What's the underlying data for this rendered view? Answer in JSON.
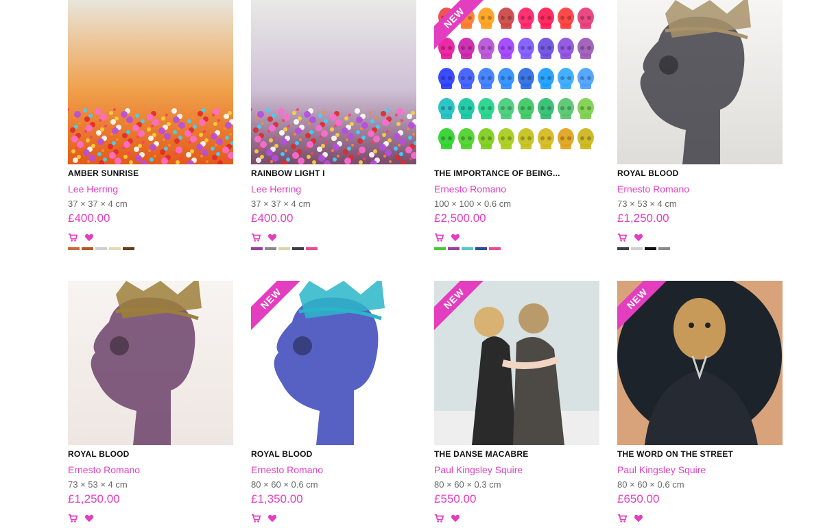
{
  "products": [
    {
      "title": "AMBER SUNRISE",
      "artist": "Lee Herring",
      "dims": "37 × 37 × 4 cm",
      "price": "£400.00",
      "new": false,
      "art": "amber-sunrise",
      "swatches": [
        "#c76a3a",
        "#b35a2c",
        "#cfcfcf",
        "#e8d9b0",
        "#6b3b14"
      ]
    },
    {
      "title": "RAINBOW LIGHT I",
      "artist": "Lee Herring",
      "dims": "37 × 37 × 4 cm",
      "price": "£400.00",
      "new": false,
      "art": "rainbow-light",
      "swatches": [
        "#9b3ea0",
        "#8a8a8a",
        "#ddd4aa",
        "#3c3f4a",
        "#e74d96"
      ]
    },
    {
      "title": "THE IMPORTANCE OF BEING...",
      "artist": "Ernesto Romano",
      "dims": "100 × 100 × 0.6 cm",
      "price": "£2,500.00",
      "new": true,
      "ribbon": "NEW",
      "art": "skull-grid",
      "swatches": [
        "#4fc73d",
        "#9b3ea0",
        "#57c9c9",
        "#334a9e",
        "#e74d96"
      ]
    },
    {
      "title": "ROYAL BLOOD",
      "artist": "Ernesto Romano",
      "dims": "73 × 53 × 4 cm",
      "price": "£1,250.00",
      "new": false,
      "art": "royal-blood-grey",
      "swatches": [
        "#3c3f4a",
        "#cfcfcf",
        "#111111",
        "#8a8a8a"
      ]
    },
    {
      "title": "ROYAL BLOOD",
      "artist": "Ernesto Romano",
      "dims": "73 × 53 × 4 cm",
      "price": "£1,250.00",
      "new": false,
      "art": "royal-blood-purple",
      "swatches": []
    },
    {
      "title": "ROYAL BLOOD",
      "artist": "Ernesto Romano",
      "dims": "80 × 60 × 0.6 cm",
      "price": "£1,350.00",
      "new": true,
      "ribbon": "NEW",
      "art": "royal-blood-blue",
      "swatches": []
    },
    {
      "title": "THE DANSE MACABRE",
      "artist": "Paul Kingsley Squire",
      "dims": "80 × 60 × 0.3 cm",
      "price": "£550.00",
      "new": true,
      "ribbon": "NEW",
      "art": "danse-macabre",
      "swatches": []
    },
    {
      "title": "THE WORD ON THE STREET",
      "artist": "Paul Kingsley Squire",
      "dims": "80 × 60 × 0.6 cm",
      "price": "£650.00",
      "new": true,
      "ribbon": "NEW",
      "art": "word-on-street",
      "swatches": []
    }
  ],
  "icons": {
    "cart": "cart-icon",
    "wishlist": "heart-icon"
  },
  "colors": {
    "accent": "#e43ec0",
    "title": "#111111",
    "dims": "#666666"
  }
}
